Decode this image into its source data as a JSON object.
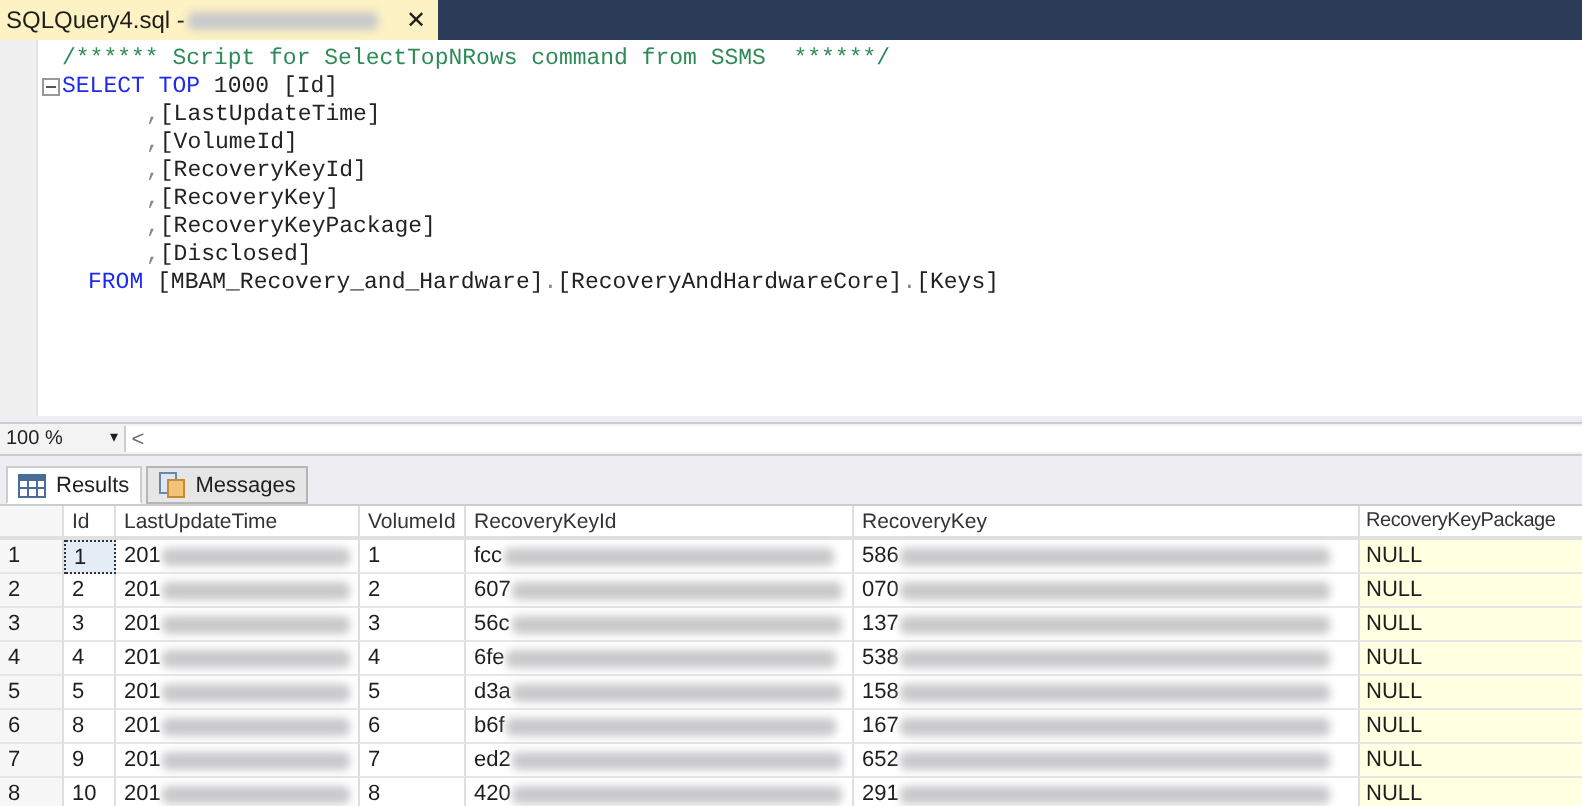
{
  "document_tab": {
    "title": "SQLQuery4.sql -",
    "close": "✕"
  },
  "editor": {
    "lines": [
      {
        "kind": "comment",
        "tokens": [
          {
            "kind": "comment",
            "text": "/****** Script for SelectTopNRows command from SSMS  ******/"
          }
        ]
      },
      {
        "kind": "select",
        "tokens": [
          {
            "kind": "keyword",
            "text": "SELECT TOP "
          },
          {
            "kind": "number",
            "text": "1000 "
          },
          {
            "kind": "text",
            "text": "[Id]"
          }
        ]
      },
      {
        "kind": "column",
        "tokens": [
          {
            "kind": "punct",
            "text": ","
          },
          {
            "kind": "text",
            "text": "[LastUpdateTime]"
          }
        ]
      },
      {
        "kind": "column",
        "tokens": [
          {
            "kind": "punct",
            "text": ","
          },
          {
            "kind": "text",
            "text": "[VolumeId]"
          }
        ]
      },
      {
        "kind": "column",
        "tokens": [
          {
            "kind": "punct",
            "text": ","
          },
          {
            "kind": "text",
            "text": "[RecoveryKeyId]"
          }
        ]
      },
      {
        "kind": "column",
        "tokens": [
          {
            "kind": "punct",
            "text": ","
          },
          {
            "kind": "text",
            "text": "[RecoveryKey]"
          }
        ]
      },
      {
        "kind": "column",
        "tokens": [
          {
            "kind": "punct",
            "text": ","
          },
          {
            "kind": "text",
            "text": "[RecoveryKeyPackage]"
          }
        ]
      },
      {
        "kind": "column",
        "tokens": [
          {
            "kind": "punct",
            "text": ","
          },
          {
            "kind": "text",
            "text": "[Disclosed]"
          }
        ]
      },
      {
        "kind": "from",
        "tokens": [
          {
            "kind": "keyword",
            "text": "FROM "
          },
          {
            "kind": "text",
            "text": "[MBAM_Recovery_and_Hardware]"
          },
          {
            "kind": "punct",
            "text": "."
          },
          {
            "kind": "text",
            "text": "[RecoveryAndHardwareCore]"
          },
          {
            "kind": "punct",
            "text": "."
          },
          {
            "kind": "text",
            "text": "[Keys]"
          }
        ]
      }
    ]
  },
  "zoom": {
    "value": "100 %",
    "dropdown": "▾",
    "scroll_left": "<"
  },
  "result_tabs": [
    {
      "label": "Results",
      "selected": true
    },
    {
      "label": "Messages",
      "selected": false
    }
  ],
  "table": {
    "columns": [
      "Id",
      "LastUpdateTime",
      "VolumeId",
      "RecoveryKeyId",
      "RecoveryKey",
      "RecoveryKeyPackage"
    ],
    "rows": [
      {
        "row": "1",
        "id": "1",
        "time": "201",
        "volume": "1",
        "key_id": "fcc",
        "key": "586",
        "package": "NULL",
        "selected": true
      },
      {
        "row": "2",
        "id": "2",
        "time": "201",
        "volume": "2",
        "key_id": "607",
        "key": "070",
        "package": "NULL",
        "selected": false
      },
      {
        "row": "3",
        "id": "3",
        "time": "201",
        "volume": "3",
        "key_id": "56c",
        "key": "137",
        "package": "NULL",
        "selected": false
      },
      {
        "row": "4",
        "id": "4",
        "time": "201",
        "volume": "4",
        "key_id": "6fe",
        "key": "538",
        "package": "NULL",
        "selected": false
      },
      {
        "row": "5",
        "id": "5",
        "time": "201",
        "volume": "5",
        "key_id": "d3a",
        "key": "158",
        "package": "NULL",
        "selected": false
      },
      {
        "row": "6",
        "id": "8",
        "time": "201",
        "volume": "6",
        "key_id": "b6f",
        "key": "167",
        "package": "NULL",
        "selected": false
      },
      {
        "row": "7",
        "id": "9",
        "time": "201",
        "volume": "7",
        "key_id": "ed2",
        "key": "652",
        "package": "NULL",
        "selected": false
      },
      {
        "row": "8",
        "id": "10",
        "time": "201",
        "volume": "8",
        "key_id": "420",
        "key": "291",
        "package": "NULL",
        "selected": false
      }
    ]
  }
}
